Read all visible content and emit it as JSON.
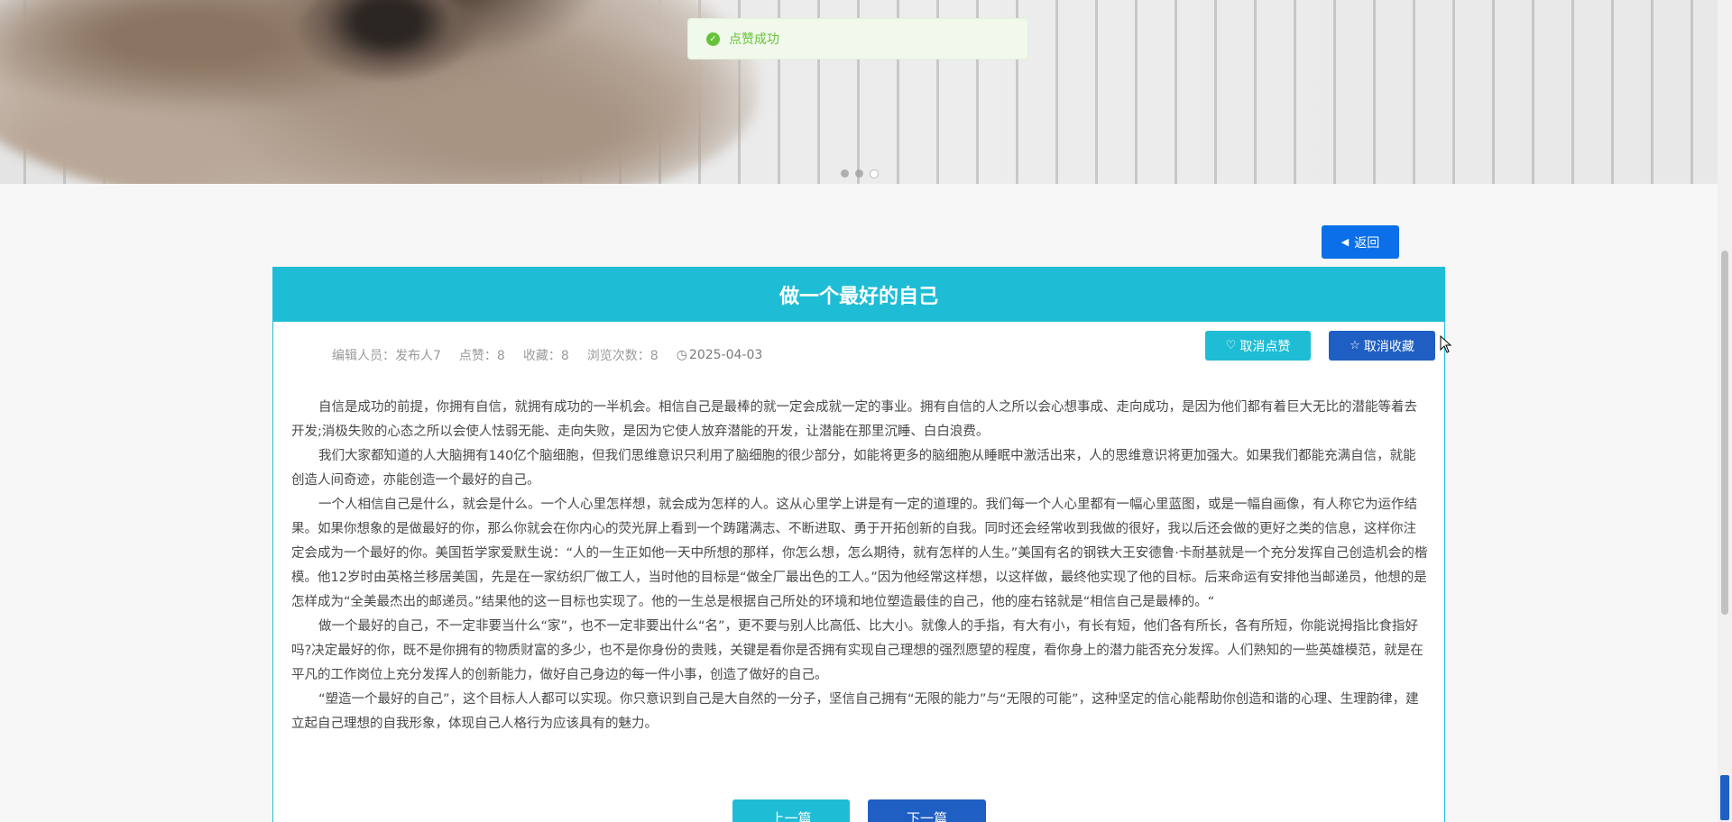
{
  "toast": {
    "message": "点赞成功",
    "icon": "check-circle-icon",
    "color": "#67c23a"
  },
  "carousel": {
    "slide_count": 3,
    "active_index": 2
  },
  "back_button": {
    "label": "返回",
    "icon": "caret-left-icon"
  },
  "article": {
    "title": "做一个最好的自己",
    "meta": {
      "editor": "编辑人员：发布人7",
      "likes": "点赞：8",
      "favorites": "收藏：8",
      "views": "浏览次数：8",
      "date": "2025-04-03"
    },
    "actions": {
      "unlike_label": "取消点赞",
      "unfavorite_label": "取消收藏"
    },
    "paragraphs": [
      "自信是成功的前提，你拥有自信，就拥有成功的一半机会。相信自己是最棒的就一定会成就一定的事业。拥有自信的人之所以会心想事成、走向成功，是因为他们都有着巨大无比的潜能等着去开发;消极失败的心态之所以会使人怯弱无能、走向失败，是因为它使人放弃潜能的开发，让潜能在那里沉睡、白白浪费。",
      "我们大家都知道的人大脑拥有140亿个脑细胞，但我们思维意识只利用了脑细胞的很少部分，如能将更多的脑细胞从睡眠中激活出来，人的思维意识将更加强大。如果我们都能充满自信，就能创造人间奇迹，亦能创造一个最好的自己。",
      "一个人相信自己是什么，就会是什么。一个人心里怎样想，就会成为怎样的人。这从心里学上讲是有一定的道理的。我们每一个人心里都有一幅心里蓝图，或是一幅自画像，有人称它为运作结果。如果你想象的是做最好的你，那么你就会在你内心的荧光屏上看到一个踌躇满志、不断进取、勇于开拓创新的自我。同时还会经常收到我做的很好，我以后还会做的更好之类的信息，这样你注定会成为一个最好的你。美国哲学家爱默生说：“人的一生正如他一天中所想的那样，你怎么想，怎么期待，就有怎样的人生。”美国有名的钢铁大王安德鲁·卡耐基就是一个充分发挥自己创造机会的楷模。他12岁时由英格兰移居美国，先是在一家纺织厂做工人，当时他的目标是“做全厂最出色的工人。”因为他经常这样想，以这样做，最终他实现了他的目标。后来命运有安排他当邮递员，他想的是怎样成为“全美最杰出的邮递员。”结果他的这一目标也实现了。他的一生总是根据自己所处的环境和地位塑造最佳的自己，他的座右铭就是“相信自己是最棒的。“",
      "做一个最好的自己，不一定非要当什么“家”，也不一定非要出什么“名”，更不要与别人比高低、比大小。就像人的手指，有大有小，有长有短，他们各有所长，各有所短，你能说拇指比食指好吗?决定最好的你，既不是你拥有的物质财富的多少，也不是你身份的贵贱，关键是看你是否拥有实现自己理想的强烈愿望的程度，看你身上的潜力能否充分发挥。人们熟知的一些英雄模范，就是在平凡的工作岗位上充分发挥人的创新能力，做好自己身边的每一件小事，创造了做好的自己。",
      "“塑造一个最好的自己”，这个目标人人都可以实现。你只意识到自己是大自然的一分子，坚信自己拥有“无限的能力”与“无限的可能”，这种坚定的信心能帮助你创造和谐的心理、生理韵律，建立起自己理想的自我形象，体现自己人格行为应该具有的魅力。"
    ],
    "nav": {
      "prev_label": "上一篇",
      "next_label": "下一篇"
    }
  }
}
